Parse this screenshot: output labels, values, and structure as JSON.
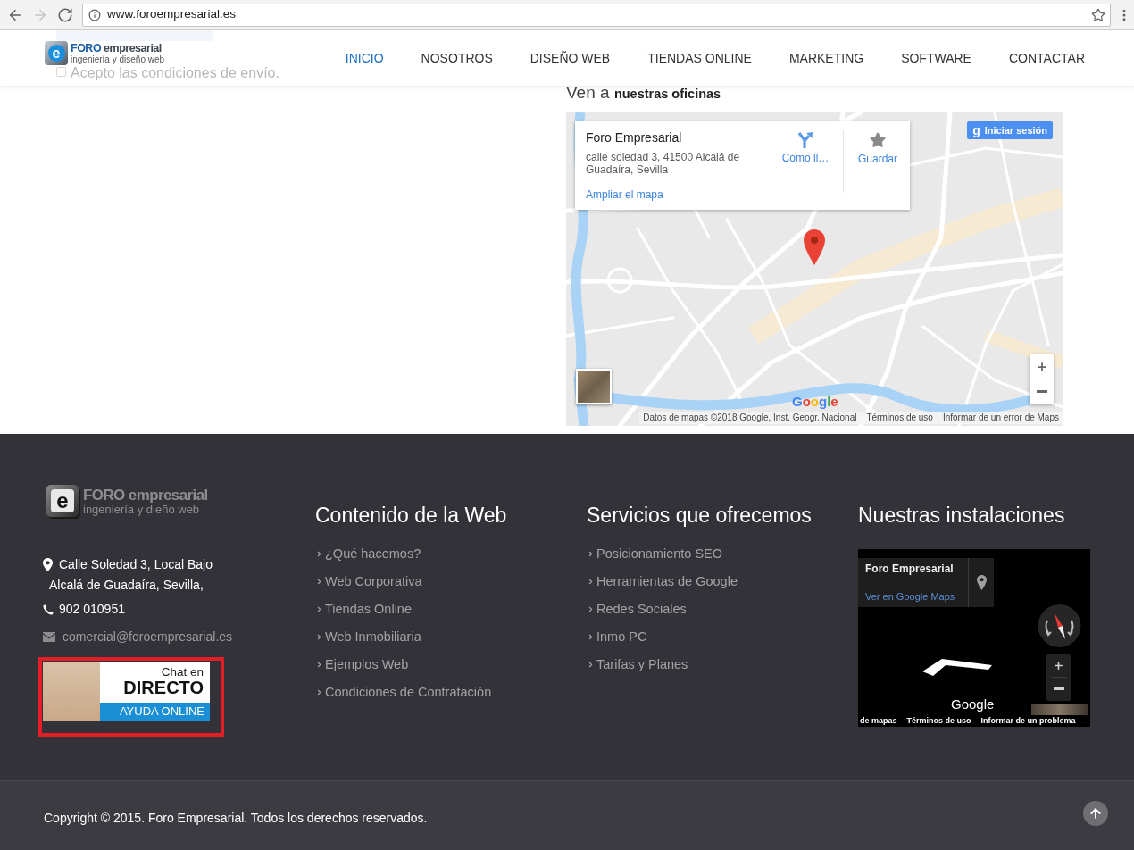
{
  "browser": {
    "nav_buttons": [
      {
        "kind": "back",
        "disabled": false
      },
      {
        "kind": "forward",
        "disabled": true
      },
      {
        "kind": "reload",
        "disabled": false
      }
    ],
    "url": "www.foroempresarial.es"
  },
  "header": {
    "logo": {
      "mark": "e",
      "brand_bold": "FORO",
      "brand_rest": "empresarial",
      "tagline": "ingeniería y diseño web"
    },
    "background_form": {
      "checkbox_label": "Acepto las condiciones de envío.",
      "checked": false
    },
    "nav": [
      {
        "label": "INICIO",
        "selected": true
      },
      {
        "label": "NOSOTROS",
        "selected": false
      },
      {
        "label": "DISEÑO WEB",
        "selected": false
      },
      {
        "label": "TIENDAS ONLINE",
        "selected": false
      },
      {
        "label": "MARKETING",
        "selected": false
      },
      {
        "label": "SOFTWARE",
        "selected": false
      },
      {
        "label": "CONTACTAR",
        "selected": false
      }
    ]
  },
  "offices": {
    "heading": "Ven a **nuestras oficinas**",
    "map": {
      "place_card": {
        "name": "Foro Empresarial",
        "address": "calle soledad 3, 41500 Alcalá de Guadaíra, Sevilla",
        "directions": "Cómo ll…",
        "save": "Guardar",
        "enlarge_link": "Ampliar el mapa"
      },
      "sign_in": {
        "glyph": "g",
        "label": "Iniciar sesión"
      },
      "logo": "Google",
      "attribution": [
        "Datos de mapas ©2018 Google, Inst. Geogr. Nacional",
        "Términos de uso",
        "Informar de un error de Maps"
      ]
    }
  },
  "footer": {
    "logo": {
      "mark": "e",
      "brand_bold": "FORO",
      "brand_rest": "empresarial",
      "tagline": "ingeniería y dieño web"
    },
    "contact": [
      {
        "kind": "address",
        "lines": [
          "Calle Soledad 3, Local Bajo",
          "Alcalá de Guadaíra, Sevilla,"
        ]
      },
      {
        "kind": "phone",
        "lines": [
          "902 010951"
        ]
      },
      {
        "kind": "email",
        "lines": [
          "comercial@foroempresarial.es"
        ]
      }
    ],
    "chat_banner": {
      "top": "Chat en",
      "main": "DIRECTO",
      "band": "AYUDA ONLINE"
    },
    "columns": [
      {
        "title": "Contenido de la Web",
        "links": [
          "¿Qué hacemos?",
          "Web Corporativa",
          "Tiendas Online",
          "Web Inmobiliaria",
          "Ejemplos Web",
          "Condiciones de Contratación"
        ]
      },
      {
        "title": "Servicios que ofrecemos",
        "links": [
          "Posicionamiento SEO",
          "Herramientas de Google",
          "Redes Sociales",
          "Inmo PC",
          "Tarifas y Planes"
        ]
      }
    ],
    "installations": {
      "title": "Nuestras instalaciones",
      "map": {
        "place_name": "Foro Empresarial",
        "link": "Ver en Google Maps",
        "logo": "Google",
        "attribution": [
          "de mapas",
          "Términos de uso",
          "Informar de un problema"
        ]
      }
    }
  },
  "bottom_bar": {
    "copyright": "Copyright © 2015. Foro Empresarial. Todos los derechos reservados."
  }
}
